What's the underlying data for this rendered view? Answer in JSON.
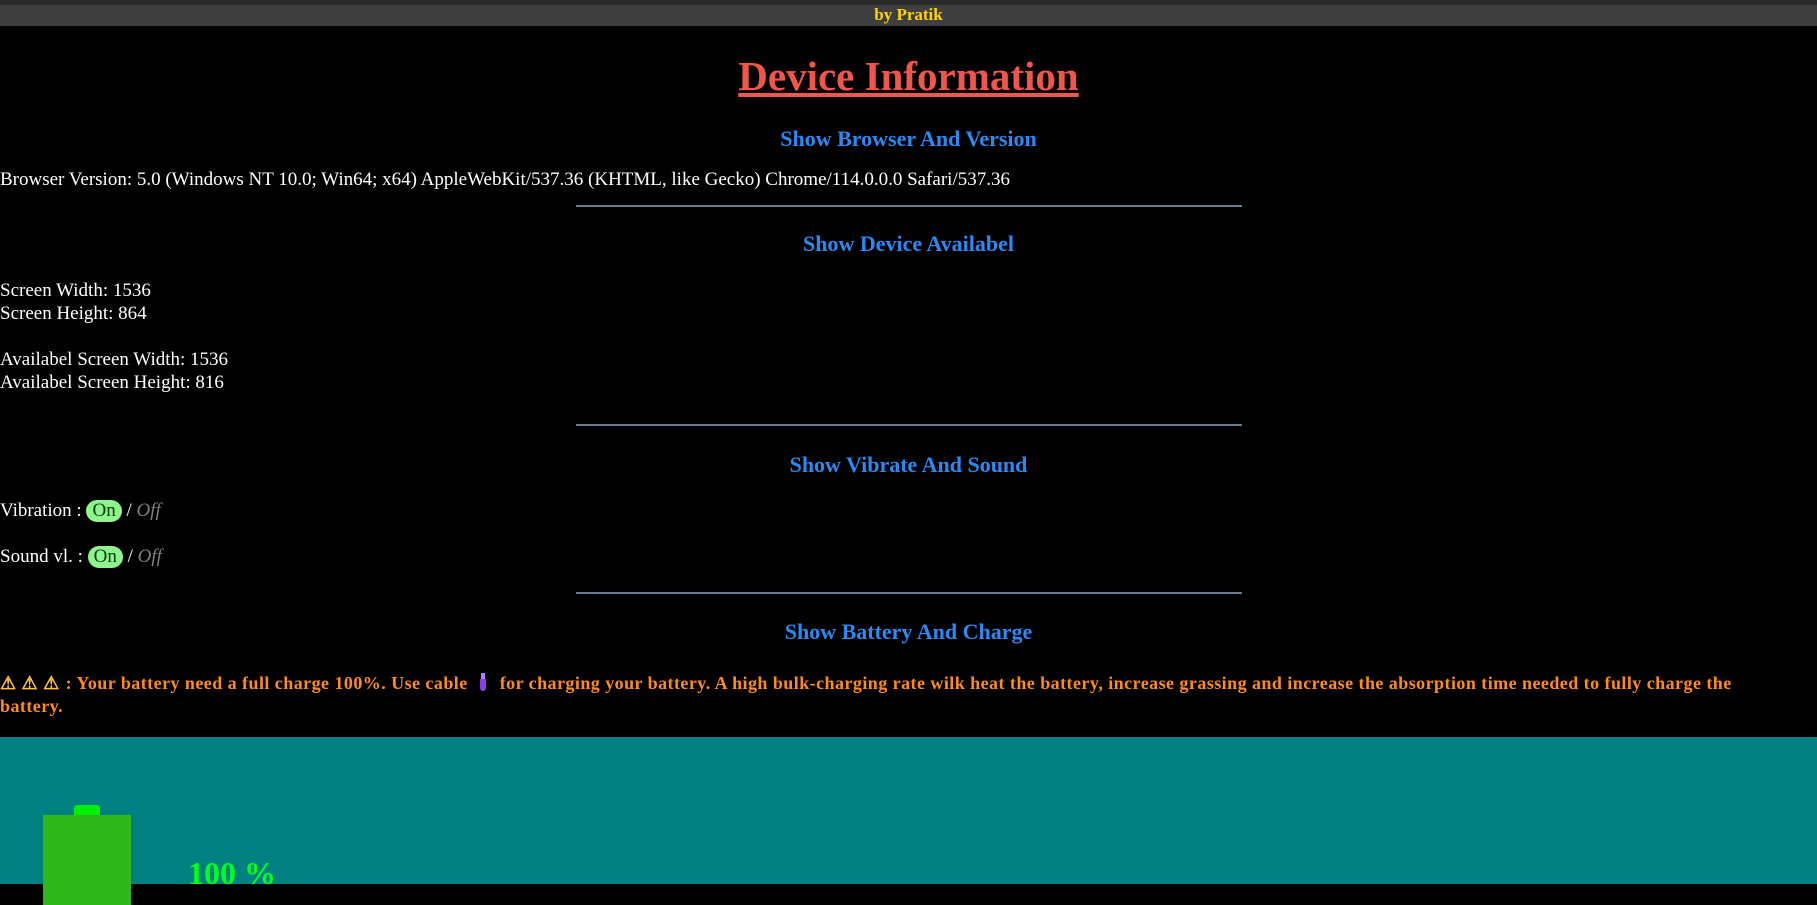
{
  "header": {
    "byline": "by Pratik"
  },
  "page": {
    "title": "Device Information"
  },
  "browser_section": {
    "heading": "Show Browser And Version",
    "version_text": "Browser Version: 5.0 (Windows NT 10.0; Win64; x64) AppleWebKit/537.36 (KHTML, like Gecko) Chrome/114.0.0.0 Safari/537.36"
  },
  "device_section": {
    "heading": "Show Device Availabel",
    "screen_width": "Screen Width: 1536",
    "screen_height": "Screen Height: 864",
    "avail_width": "Availabel Screen Width: 1536",
    "avail_height": "Availabel Screen Height: 816"
  },
  "vibrate_section": {
    "heading": "Show Vibrate And Sound",
    "vibration_label": "Vibration :",
    "sound_label": "Sound vl. :",
    "on_label": "On",
    "separator": "/",
    "off_label": "Off"
  },
  "battery_section": {
    "heading": "Show Battery And Charge",
    "warning_icons": "⚠ ⚠ ⚠",
    "warning_part1": ": Your battery need a full charge 100%. Use cable",
    "warning_part2": "for charging your battery. A high bulk-charging rate wilk heat the battery, increase grassing and increase the absorption time needed to fully charge the",
    "warning_line2": "battery.",
    "percent_text": "100 %",
    "level_percent": 100
  },
  "colors": {
    "title": "#f0564a",
    "heading": "#2a8af5",
    "byline": "#ffd400",
    "warning": "#ff8c1a",
    "battery_bg": "#008080",
    "battery_fill": "#2fb81c",
    "toggle_on": "#8ef58e"
  },
  "icons": {
    "warning": "warning-triangle-icon",
    "cable": "plug-icon",
    "battery": "battery-icon"
  }
}
